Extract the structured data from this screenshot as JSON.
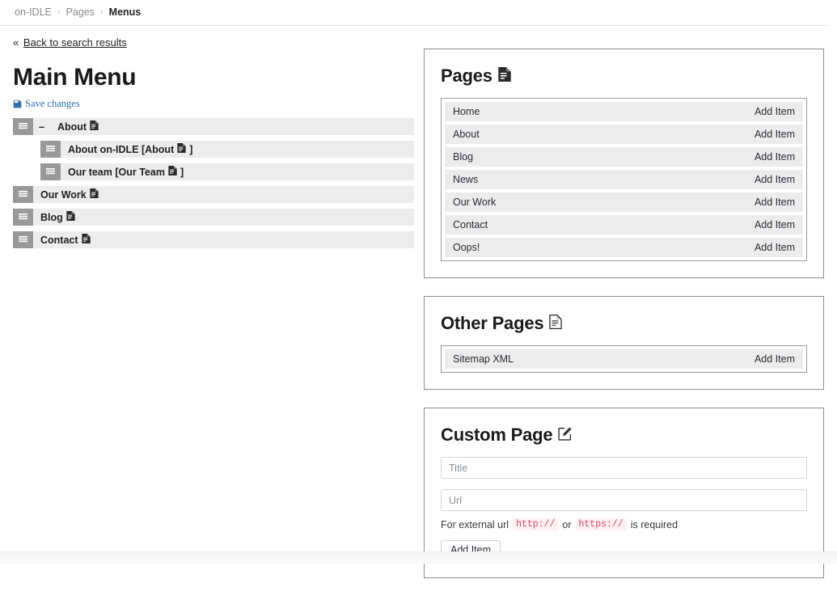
{
  "breadcrumb": {
    "items": [
      {
        "label": "on-IDLE",
        "current": false
      },
      {
        "label": "Pages",
        "current": false
      },
      {
        "label": "Menus",
        "current": true
      }
    ],
    "separator": "›"
  },
  "back": {
    "chevron": "«",
    "label": "Back to search results"
  },
  "menu": {
    "title": "Main Menu",
    "save_label": "Save changes",
    "collapse_symbol": "–",
    "items": [
      {
        "label": "About",
        "icon": "document-icon",
        "level": 0,
        "collapsible": true
      },
      {
        "label": "About on-IDLE [About",
        "suffix": "]",
        "icon": "document-icon",
        "level": 1,
        "collapsible": false
      },
      {
        "label": "Our team [Our Team",
        "suffix": "]",
        "icon": "document-icon",
        "level": 1,
        "collapsible": false
      },
      {
        "label": "Our Work",
        "icon": "document-icon",
        "level": 0,
        "collapsible": false
      },
      {
        "label": "Blog",
        "icon": "document-icon",
        "level": 0,
        "collapsible": false
      },
      {
        "label": "Contact",
        "icon": "document-icon",
        "level": 0,
        "collapsible": false
      }
    ]
  },
  "pages_panel": {
    "title": "Pages",
    "icon": "document-filled-icon",
    "add_label": "Add Item",
    "items": [
      {
        "label": "Home"
      },
      {
        "label": "About"
      },
      {
        "label": "Blog"
      },
      {
        "label": "News"
      },
      {
        "label": "Our Work"
      },
      {
        "label": "Contact"
      },
      {
        "label": "Oops!"
      }
    ]
  },
  "other_pages_panel": {
    "title": "Other Pages",
    "icon": "document-outline-icon",
    "add_label": "Add Item",
    "items": [
      {
        "label": "Sitemap XML"
      }
    ]
  },
  "custom_page_panel": {
    "title": "Custom Page",
    "icon": "edit-pencil-icon",
    "title_input": {
      "value": "",
      "placeholder": "Title"
    },
    "url_input": {
      "value": "",
      "placeholder": "Url"
    },
    "hint": {
      "prefix": "For external url",
      "code1": "http://",
      "middle": "or",
      "code2": "https://",
      "suffix": "is required"
    },
    "add_button": "Add Item"
  },
  "colors": {
    "link": "#2f6fad",
    "row_bg": "#ececec",
    "handle": "#999999",
    "panel_border": "#8c8c8c",
    "code_text": "#e0446d",
    "code_bg": "#fdf0f2"
  }
}
